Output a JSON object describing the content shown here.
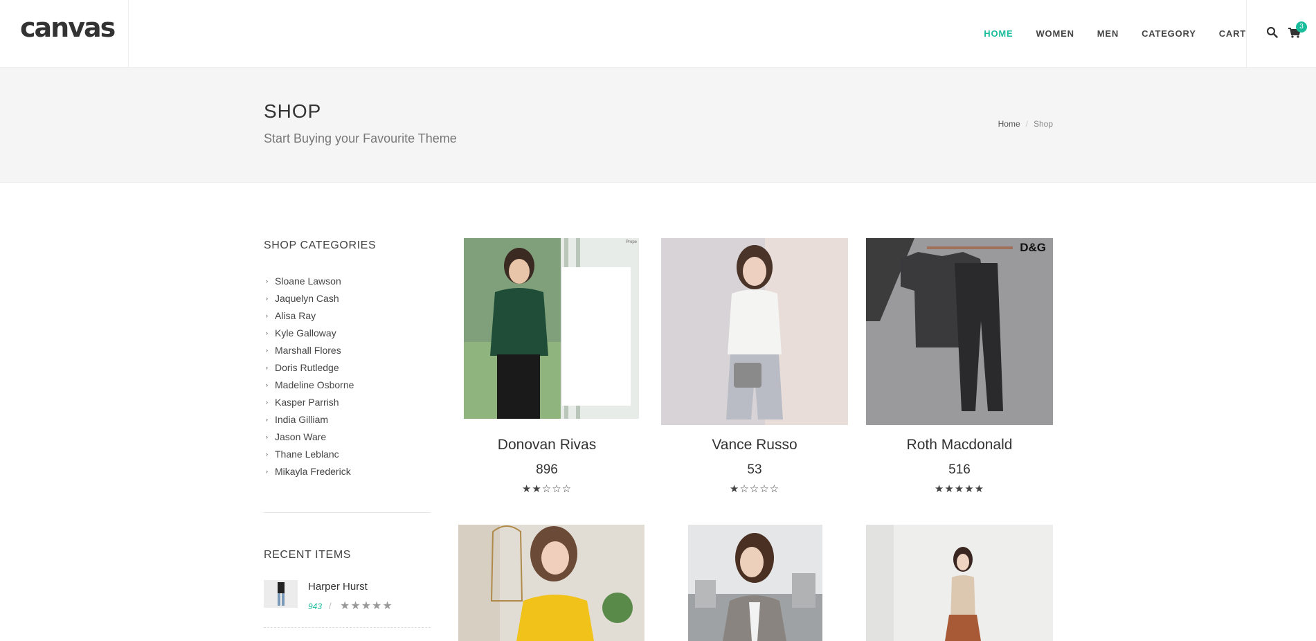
{
  "header": {
    "logo": "canvas",
    "nav": [
      "HOME",
      "WOMEN",
      "MEN",
      "CATEGORY",
      "CART"
    ],
    "cart_count": "3"
  },
  "page_title": {
    "title": "SHOP",
    "subtitle": "Start Buying your Favourite Theme",
    "breadcrumb": {
      "home": "Home",
      "separator": "/",
      "current": "Shop"
    }
  },
  "sidebar": {
    "categories_title": "SHOP CATEGORIES",
    "categories": [
      "Sloane Lawson",
      "Jaquelyn Cash",
      "Alisa Ray",
      "Kyle Galloway",
      "Marshall Flores",
      "Doris Rutledge",
      "Madeline Osborne",
      "Kasper Parrish",
      "India Gilliam",
      "Jason Ware",
      "Thane Leblanc",
      "Mikayla Frederick"
    ],
    "recent_title": "RECENT ITEMS",
    "recent": {
      "name": "Harper Hurst",
      "price": "943",
      "separator": "/",
      "rating": 5
    }
  },
  "products": [
    {
      "name": "Donovan Rivas",
      "price": "896",
      "rating": 2,
      "image_label": "Prope"
    },
    {
      "name": "Vance Russo",
      "price": "53",
      "rating": 1
    },
    {
      "name": "Roth Macdonald",
      "price": "516",
      "rating": 5,
      "image_label": "D&G"
    },
    {
      "name": "",
      "price": "",
      "rating": 0
    },
    {
      "name": "",
      "price": "",
      "rating": 0
    },
    {
      "name": "",
      "price": "",
      "rating": 0
    }
  ],
  "colors": {
    "accent": "#1abc9c",
    "title_bg": "#f5f5f5"
  }
}
